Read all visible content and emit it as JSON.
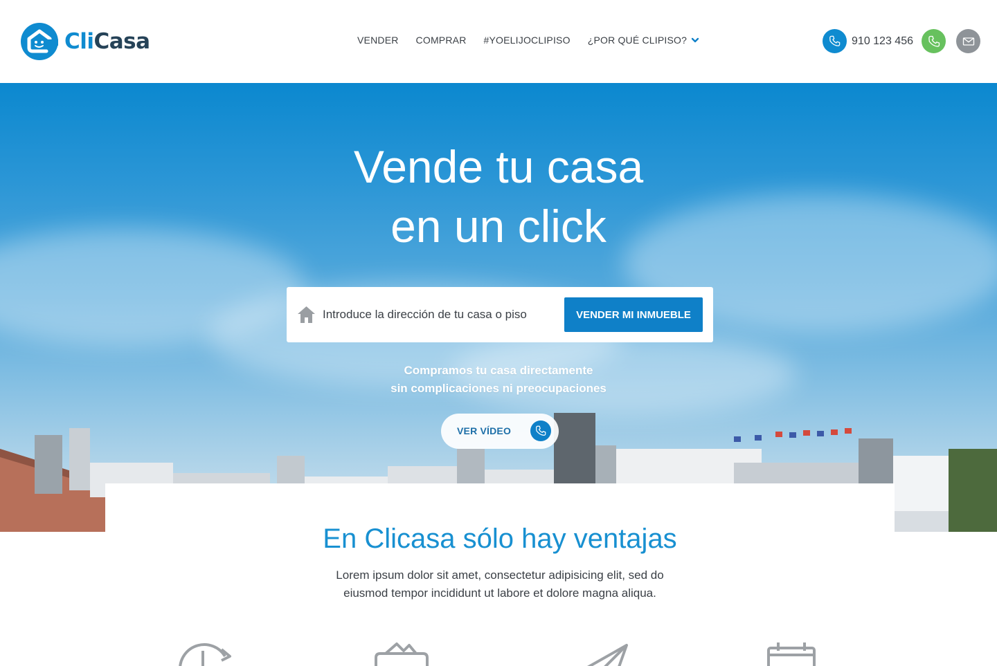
{
  "brand": {
    "part1": "Cli",
    "part2": "Casa"
  },
  "nav": [
    {
      "label": "VENDER"
    },
    {
      "label": "COMPRAR"
    },
    {
      "label": "#YOELIJOCLIPISO"
    },
    {
      "label": "¿POR QUÉ CLIPISO?",
      "icon": "chevron-down-icon"
    }
  ],
  "contact": {
    "phone": "910 123 456",
    "phone_icon": "phone-icon",
    "whatsapp_icon": "whatsapp-icon",
    "mail_icon": "mail-icon"
  },
  "hero": {
    "title_line1": "Vende tu casa",
    "title_line2": "en un click",
    "search_placeholder": "Introduce la dirección de tu casa o piso",
    "search_icon": "house-icon",
    "cta_label": "VENDER MI INMUEBLE",
    "subtitle_line1": "Compramos tu casa directamente",
    "subtitle_line2": "sin complicaciones ni preocupaciones",
    "video_label": "VER VÍDEO",
    "video_icon": "phone-icon"
  },
  "advantages": {
    "title": "En Clicasa sólo hay ventajas",
    "text_line1": "Lorem ipsum dolor sit amet, consectetur adipisicing elit, sed do",
    "text_line2": "eiusmod tempor incididunt ut labore et dolore magna aliqua.",
    "icons": [
      "clock-refresh-icon",
      "wallet-icon",
      "paper-plane-icon",
      "calendar-icon"
    ]
  },
  "colors": {
    "brand_blue": "#0f8bd0",
    "brand_dark": "#264358",
    "cta_blue": "#0f80c8",
    "whatsapp_green": "#67c15e",
    "mail_gray": "#8e9398",
    "title_blue": "#1890d1"
  }
}
